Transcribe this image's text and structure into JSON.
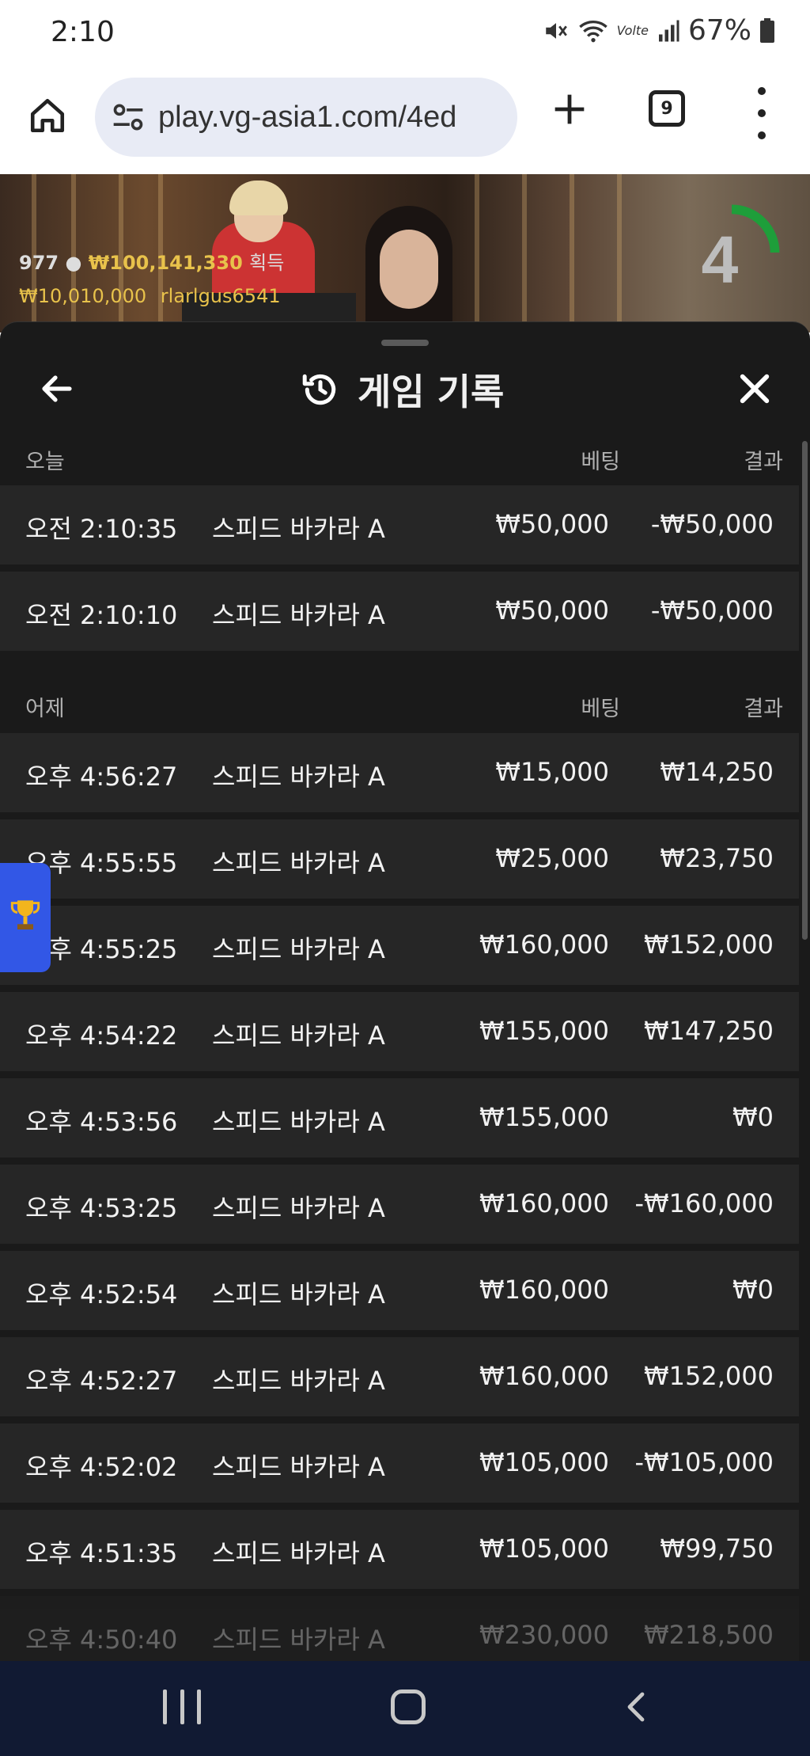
{
  "status_bar": {
    "time": "2:10",
    "battery": "67%",
    "network_label": "Volte"
  },
  "browser": {
    "url": "play.vg-asia1.com/4ed",
    "tab_count": "9"
  },
  "video": {
    "players_count": "977",
    "total_amount": "₩100,141,330",
    "total_suffix": "획득",
    "winner_amount": "₩10,010,000",
    "winner_name": "rlarlgus6541",
    "timer_value": "4"
  },
  "sheet": {
    "title": "게임 기록",
    "sections": [
      {
        "label": "오늘",
        "bet_header": "베팅",
        "result_header": "결과",
        "rows": [
          {
            "time": "오전 2:10:35",
            "game": "스피드 바카라 A",
            "bet": "₩50,000",
            "result": "-₩50,000"
          },
          {
            "time": "오전 2:10:10",
            "game": "스피드 바카라 A",
            "bet": "₩50,000",
            "result": "-₩50,000"
          }
        ]
      },
      {
        "label": "어제",
        "bet_header": "베팅",
        "result_header": "결과",
        "rows": [
          {
            "time": "오후 4:56:27",
            "game": "스피드 바카라 A",
            "bet": "₩15,000",
            "result": "₩14,250"
          },
          {
            "time": "오후 4:55:55",
            "game": "스피드 바카라 A",
            "bet": "₩25,000",
            "result": "₩23,750"
          },
          {
            "time": "오후 4:55:25",
            "game": "스피드 바카라 A",
            "bet": "₩160,000",
            "result": "₩152,000"
          },
          {
            "time": "오후 4:54:22",
            "game": "스피드 바카라 A",
            "bet": "₩155,000",
            "result": "₩147,250"
          },
          {
            "time": "오후 4:53:56",
            "game": "스피드 바카라 A",
            "bet": "₩155,000",
            "result": "₩0"
          },
          {
            "time": "오후 4:53:25",
            "game": "스피드 바카라 A",
            "bet": "₩160,000",
            "result": "-₩160,000"
          },
          {
            "time": "오후 4:52:54",
            "game": "스피드 바카라 A",
            "bet": "₩160,000",
            "result": "₩0"
          },
          {
            "time": "오후 4:52:27",
            "game": "스피드 바카라 A",
            "bet": "₩160,000",
            "result": "₩152,000"
          },
          {
            "time": "오후 4:52:02",
            "game": "스피드 바카라 A",
            "bet": "₩105,000",
            "result": "-₩105,000"
          },
          {
            "time": "오후 4:51:35",
            "game": "스피드 바카라 A",
            "bet": "₩105,000",
            "result": "₩99,750"
          },
          {
            "time": "오후 4:50:40",
            "game": "스피드 바카라 A",
            "bet": "₩230,000",
            "result": "₩218,500"
          }
        ]
      }
    ]
  },
  "colors": {
    "sheet_bg": "#1a1a1a",
    "row_bg": "#262626",
    "accent_gold": "#e8c24b",
    "trophy_tab": "#3257e6",
    "timer_green": "#1e9e3a"
  }
}
